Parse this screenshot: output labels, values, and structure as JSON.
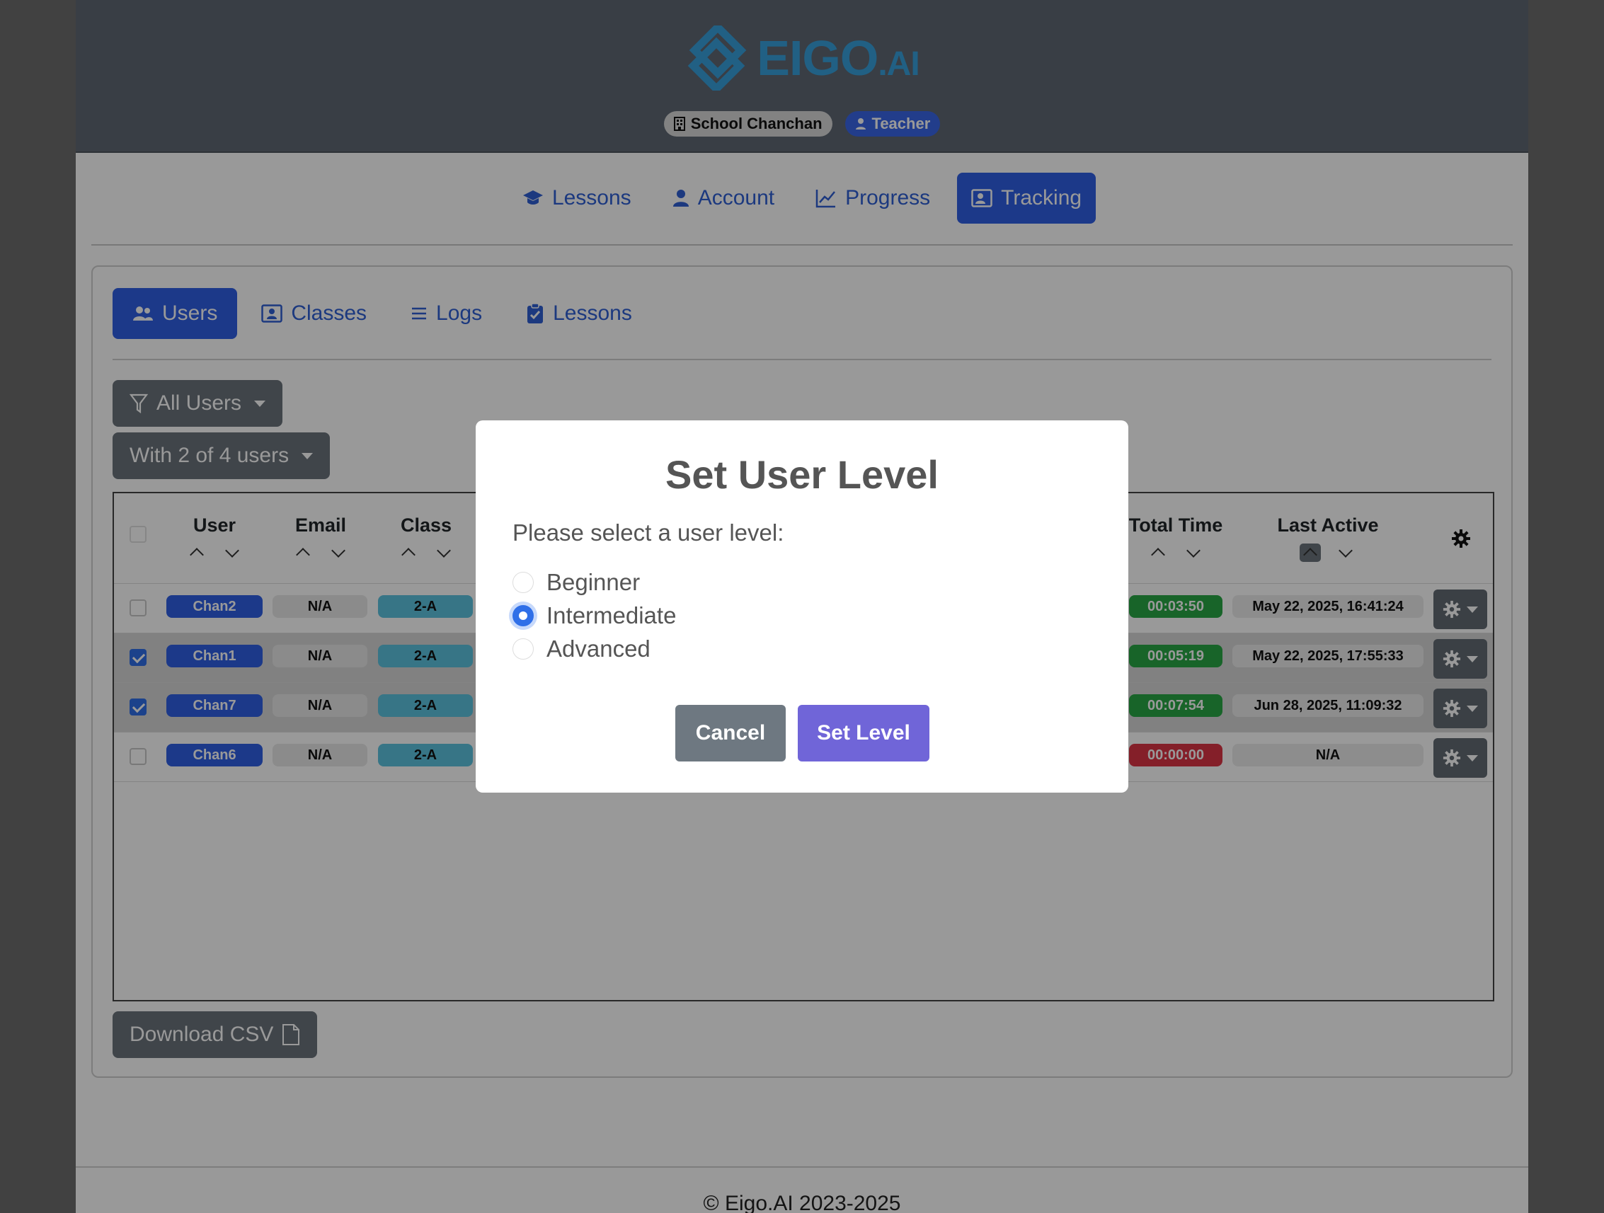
{
  "header": {
    "logo_text": "EIGO",
    "logo_suffix": ".AI",
    "school_badge": "School Chanchan",
    "role_badge": "Teacher"
  },
  "main_nav": [
    {
      "label": "Lessons",
      "icon": "graduation-cap-icon"
    },
    {
      "label": "Account",
      "icon": "person-icon"
    },
    {
      "label": "Progress",
      "icon": "chart-line-icon"
    },
    {
      "label": "Tracking",
      "icon": "person-badge-icon",
      "active": true
    }
  ],
  "sub_nav": [
    {
      "label": "Users",
      "icon": "people-icon",
      "active": true
    },
    {
      "label": "Classes",
      "icon": "person-badge-icon"
    },
    {
      "label": "Logs",
      "icon": "list-icon"
    },
    {
      "label": "Lessons",
      "icon": "clipboard-check-icon"
    }
  ],
  "filters": {
    "user_filter": "All Users",
    "selection": "With 2 of 4 users"
  },
  "table": {
    "columns": {
      "user": "User",
      "email": "Email",
      "class": "Class",
      "total_time": "Total Time",
      "last_active": "Last Active"
    },
    "rows": [
      {
        "user": "Chan2",
        "email": "N/A",
        "class": "2-A",
        "total_time": "00:03:50",
        "last_active": "May 22, 2025, 16:41:24",
        "selected": false,
        "time_color": "#28a745"
      },
      {
        "user": "Chan1",
        "email": "N/A",
        "class": "2-A",
        "total_time": "00:05:19",
        "last_active": "May 22, 2025, 17:55:33",
        "selected": true,
        "time_color": "#28a745"
      },
      {
        "user": "Chan7",
        "email": "N/A",
        "class": "2-A",
        "total_time": "00:07:54",
        "last_active": "Jun 28, 2025, 11:09:32",
        "selected": true,
        "time_color": "#28a745"
      },
      {
        "user": "Chan6",
        "email": "N/A",
        "class": "2-A",
        "total_time": "00:00:00",
        "last_active": "N/A",
        "selected": false,
        "time_color": "#dc3545"
      }
    ]
  },
  "download_csv": "Download CSV",
  "footer": "© Eigo.AI 2023-2025",
  "modal": {
    "title": "Set User Level",
    "prompt": "Please select a user level:",
    "options": [
      {
        "label": "Beginner",
        "checked": false
      },
      {
        "label": "Intermediate",
        "checked": true
      },
      {
        "label": "Advanced",
        "checked": false
      }
    ],
    "cancel": "Cancel",
    "confirm": "Set Level"
  },
  "colors": {
    "primary": "#2f5fe4",
    "confirm_button": "#7065d8",
    "cancel_button": "#6e7881",
    "logo": "#37a0dc"
  }
}
